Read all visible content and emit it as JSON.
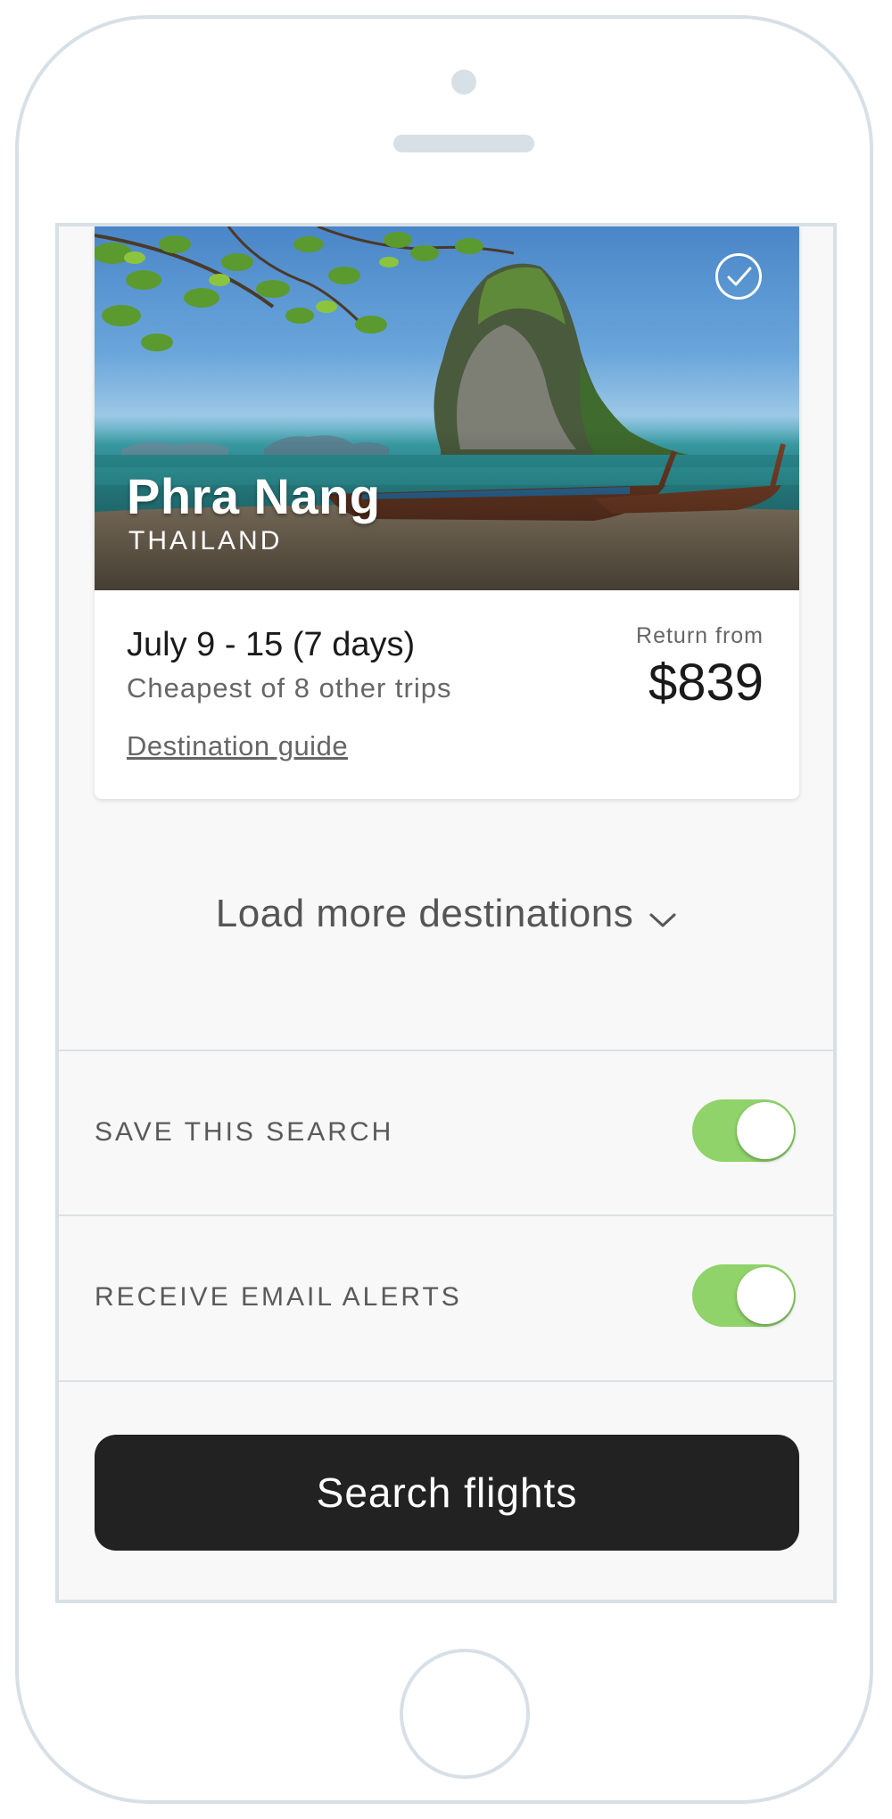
{
  "card": {
    "destination": "Phra Nang",
    "country": "THAILAND",
    "dates": "July 9 - 15 (7 days)",
    "cheapest_note": "Cheapest of 8 other trips",
    "guide_link": "Destination guide",
    "return_label": "Return from",
    "price": "$839",
    "selected": true
  },
  "load_more": {
    "label": "Load more destinations",
    "icon": "chevron-down-icon"
  },
  "settings": [
    {
      "label": "SAVE THIS SEARCH",
      "enabled": true
    },
    {
      "label": "RECEIVE EMAIL ALERTS",
      "enabled": true
    }
  ],
  "search_button": {
    "label": "Search flights"
  },
  "colors": {
    "toggle_on": "#8fd36a",
    "button_bg": "#222222",
    "phone_frame": "#d7e0e6",
    "screen_bg": "#f8f8f8"
  }
}
